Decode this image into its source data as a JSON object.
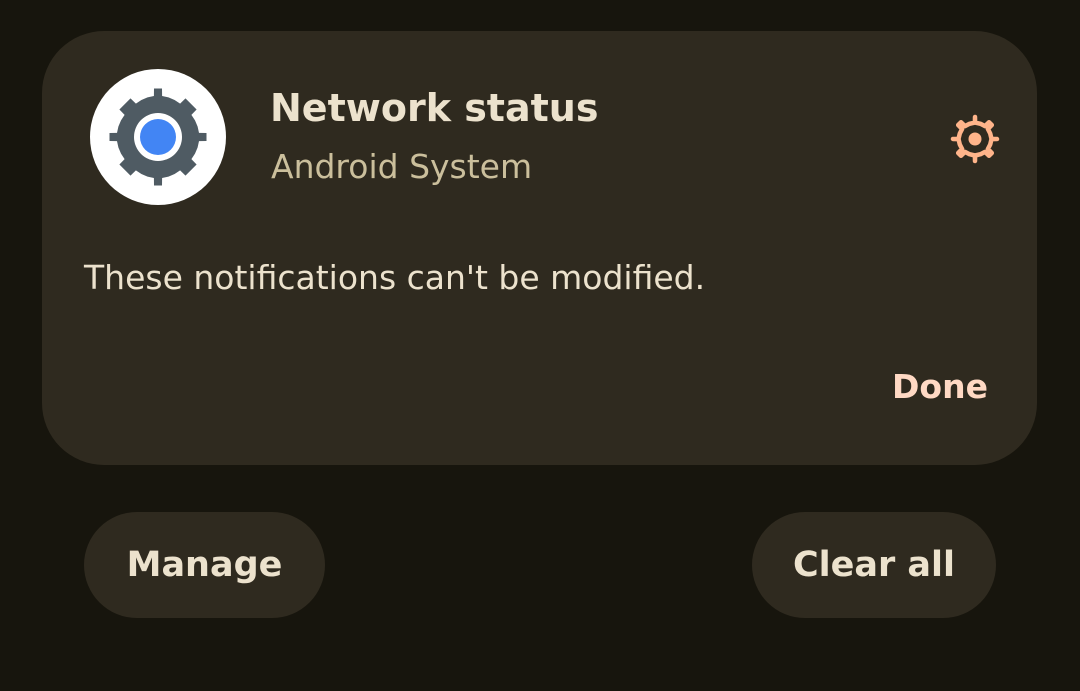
{
  "notification": {
    "title": "Network status",
    "app_name": "Android System",
    "app_icon": "android-system-gear-icon",
    "settings_icon": "gear-icon",
    "message": "These notifications can't be modified.",
    "done_label": "Done"
  },
  "actions": {
    "manage_label": "Manage",
    "clear_all_label": "Clear all"
  },
  "colors": {
    "background": "#17150d",
    "card": "#2f2a1f",
    "accent": "#ffb48a",
    "done_text": "#ffd9c4",
    "primary_text": "#ece2cd",
    "secondary_text": "#cbbf9c",
    "icon_gear": "#4f5b63",
    "icon_center": "#4285f4"
  }
}
